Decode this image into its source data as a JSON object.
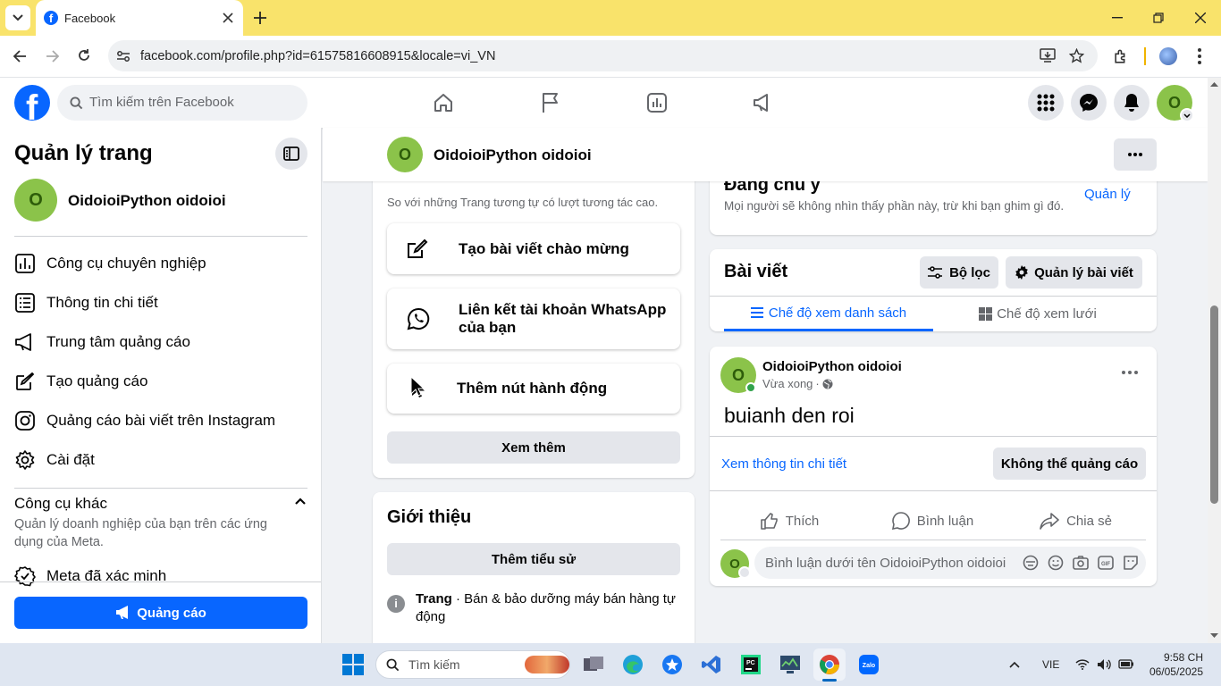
{
  "browser": {
    "tab_title": "Facebook",
    "url": "facebook.com/profile.php?id=61575816608915&locale=vi_VN"
  },
  "fb_header": {
    "search_placeholder": "Tìm kiếm trên Facebook",
    "avatar_letter": "O"
  },
  "sidebar": {
    "title": "Quản lý trang",
    "page_name": "OidoioiPython oidoioi",
    "avatar_letter": "O",
    "items": [
      {
        "label": "Công cụ chuyên nghiệp",
        "icon": "insights-icon"
      },
      {
        "label": "Thông tin chi tiết",
        "icon": "list-details-icon"
      },
      {
        "label": "Trung tâm quảng cáo",
        "icon": "megaphone-icon"
      },
      {
        "label": "Tạo quảng cáo",
        "icon": "pencil-icon"
      },
      {
        "label": "Quảng cáo bài viết trên Instagram",
        "icon": "instagram-icon"
      },
      {
        "label": "Cài đặt",
        "icon": "gear-icon"
      }
    ],
    "other_tools_title": "Công cụ khác",
    "other_tools_desc": "Quản lý doanh nghiệp của bạn trên các ứng dụng của Meta.",
    "meta_verified": "Meta đã xác minh",
    "ads_button": "Quảng cáo"
  },
  "page_header": {
    "name": "OidoioiPython oidoioi",
    "avatar_letter": "O"
  },
  "left_col": {
    "similar_note": "So với những Trang tương tự có lượt tương tác cao.",
    "actions": [
      "Tạo bài viết chào mừng",
      "Liên kết tài khoản WhatsApp của bạn",
      "Thêm nút hành động"
    ],
    "see_more": "Xem thêm",
    "intro_title": "Giới thiệu",
    "add_bio": "Thêm tiểu sử",
    "category_label": "Trang",
    "category_value": " · Bán & bảo dưỡng máy bán hàng tự động"
  },
  "featured": {
    "title": "Đáng chú ý",
    "desc": "Mọi người sẽ không nhìn thấy phần này, trừ khi bạn ghim gì đó.",
    "manage": "Quản lý"
  },
  "posts": {
    "title": "Bài viết",
    "filter": "Bộ lọc",
    "manage_posts": "Quản lý bài viết",
    "tab_list": "Chế độ xem danh sách",
    "tab_grid": "Chế độ xem lưới"
  },
  "post": {
    "author": "OidoioiPython oidoioi",
    "time": "Vừa xong",
    "text": "buianh den roi",
    "view_details": "Xem thông tin chi tiết",
    "cannot_boost": "Không thể quảng cáo",
    "like": "Thích",
    "comment": "Bình luận",
    "share": "Chia sẻ",
    "comment_placeholder": "Bình luận dưới tên OidoioiPython oidoioi",
    "avatar_letter": "O"
  },
  "taskbar": {
    "search_placeholder": "Tìm kiếm",
    "lang": "VIE",
    "time": "9:58 CH",
    "date": "06/05/2025"
  },
  "colors": {
    "fb_blue": "#0866ff",
    "tab_bar": "#f9e36b",
    "avatar_green": "#8bc34a"
  }
}
